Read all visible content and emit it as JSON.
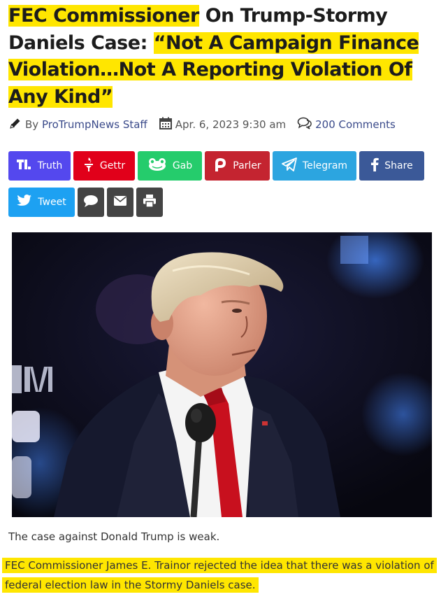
{
  "article": {
    "title_part1": "FEC Commissioner",
    "title_part2": " On Trump-Stormy Daniels Case: ",
    "title_part3": "“Not A Campaign Finance Violation…Not A Reporting Violation Of Any Kind”",
    "byline_prefix": "By ",
    "author": "ProTrumpNews Staff",
    "date": "Apr. 6, 2023 9:30 am",
    "comments": "200 Comments",
    "photo_caption": "The case against Donald Trump is weak.",
    "lead_paragraph": "FEC Commissioner James E. Trainor rejected the idea that there was a violation of federal election law in the Stormy Daniels case."
  },
  "share_buttons": [
    {
      "label": "Truth",
      "color": "#5448ee",
      "icon": "truth-social-icon"
    },
    {
      "label": "Gettr",
      "color": "#e1001a",
      "icon": "gettr-icon"
    },
    {
      "label": "Gab",
      "color": "#25cc6c",
      "icon": "gab-frog-icon"
    },
    {
      "label": "Parler",
      "color": "#c42430",
      "icon": "parler-icon"
    },
    {
      "label": "Telegram",
      "color": "#2ca5e0",
      "icon": "telegram-icon"
    },
    {
      "label": "Share",
      "color": "#3b5998",
      "icon": "facebook-icon"
    },
    {
      "label": "Tweet",
      "color": "#1da1f2",
      "icon": "twitter-icon"
    },
    {
      "label": "",
      "color": "#444444",
      "icon": "comment-icon"
    },
    {
      "label": "",
      "color": "#444444",
      "icon": "email-icon"
    },
    {
      "label": "",
      "color": "#444444",
      "icon": "print-icon"
    }
  ],
  "icons": {
    "author": "pencil-icon",
    "date": "calendar-icon",
    "comments": "comment-bubbles-icon"
  },
  "colors": {
    "highlight": "#ffe600",
    "link": "#3a4a8a"
  }
}
